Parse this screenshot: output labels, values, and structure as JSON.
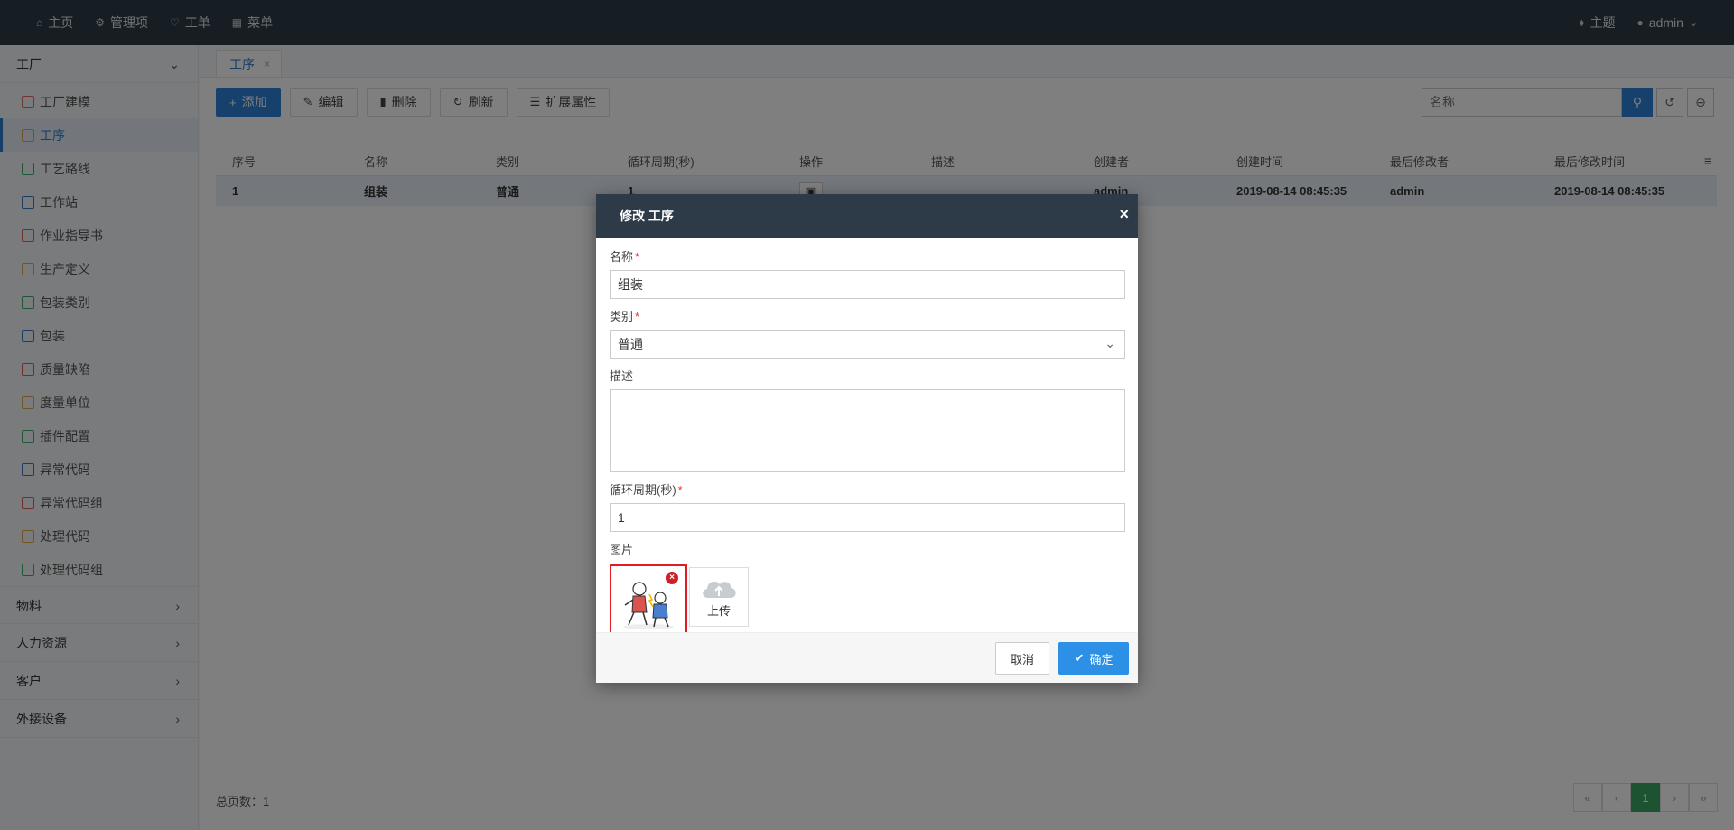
{
  "topbar": {
    "nav": [
      {
        "icon": "home-icon",
        "glyph": "⌂",
        "label": "主页"
      },
      {
        "icon": "gear-icon",
        "glyph": "⚙",
        "label": "管理项"
      },
      {
        "icon": "workorder-icon",
        "glyph": "♡",
        "label": "工单"
      },
      {
        "icon": "grid-icon",
        "glyph": "▦",
        "label": "菜单"
      }
    ],
    "theme_label": "主题",
    "user_label": "admin"
  },
  "sidebar": {
    "groups": [
      {
        "label": "工厂",
        "expanded": true
      },
      {
        "label": "物料",
        "expanded": false
      },
      {
        "label": "人力资源",
        "expanded": false
      },
      {
        "label": "客户",
        "expanded": false
      },
      {
        "label": "外接设备",
        "expanded": false
      }
    ],
    "items": [
      {
        "label": "工厂建模",
        "color": "#e06b6b"
      },
      {
        "label": "工序",
        "color": "#e0a94a",
        "active": true
      },
      {
        "label": "工艺路线",
        "color": "#3cae6a"
      },
      {
        "label": "工作站",
        "color": "#3a78c9"
      },
      {
        "label": "作业指导书",
        "color": "#e05a5a"
      },
      {
        "label": "生产定义",
        "color": "#e0a94a"
      },
      {
        "label": "包装类别",
        "color": "#3cae6a"
      },
      {
        "label": "包装",
        "color": "#3a78c9"
      },
      {
        "label": "质量缺陷",
        "color": "#e05a5a"
      },
      {
        "label": "度量单位",
        "color": "#e0a94a"
      },
      {
        "label": "插件配置",
        "color": "#3cae6a"
      },
      {
        "label": "异常代码",
        "color": "#3a78c9"
      },
      {
        "label": "异常代码组",
        "color": "#e05a5a"
      },
      {
        "label": "处理代码",
        "color": "#e0a94a"
      },
      {
        "label": "处理代码组",
        "color": "#3cae6a"
      }
    ]
  },
  "tab": {
    "label": "工序",
    "close": "×"
  },
  "toolbar": {
    "add": "添加",
    "edit": "编辑",
    "delete": "删除",
    "refresh": "刷新",
    "ext": "扩展属性"
  },
  "search": {
    "placeholder": "名称"
  },
  "table": {
    "headers": [
      "序号",
      "名称",
      "类别",
      "循环周期(秒)",
      "操作",
      "描述",
      "创建者",
      "创建时间",
      "最后修改者",
      "最后修改时间"
    ],
    "rows": [
      [
        "1",
        "组装",
        "普通",
        "1",
        "",
        "",
        "admin",
        "2019-08-14 08:45:35",
        "admin",
        "2019-08-14 08:45:35"
      ]
    ]
  },
  "footer": {
    "total": "总页数：1",
    "current_page": "1"
  },
  "modal": {
    "title": "修改 工序",
    "close": "×",
    "name_label": "名称",
    "name_value": "组装",
    "type_label": "类别",
    "type_value": "普通",
    "desc_label": "描述",
    "desc_value": "",
    "cycle_label": "循环周期(秒)",
    "cycle_value": "1",
    "image_label": "图片",
    "upload_label": "上传",
    "cancel": "取消",
    "ok": "确定"
  },
  "colors": {
    "topbar": "#2d3a47",
    "primary": "#2b82d9",
    "pager_active": "#3aa661",
    "highlight_border": "#e01b22"
  }
}
